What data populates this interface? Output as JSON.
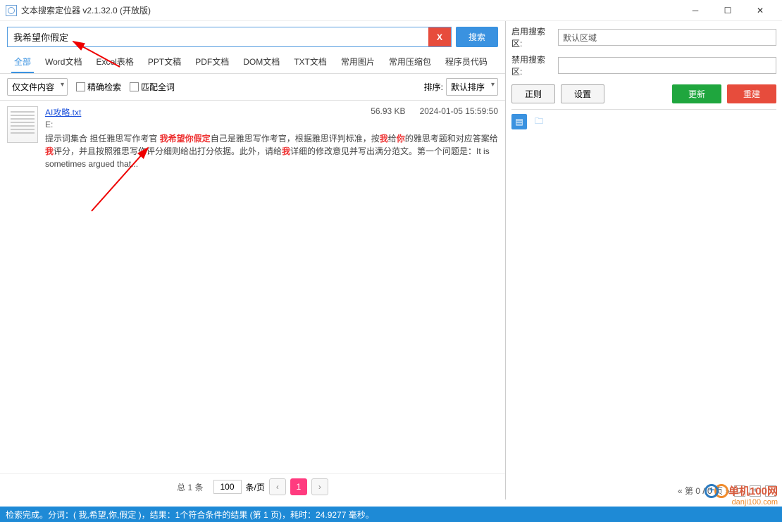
{
  "title": "文本搜索定位器 v2.1.32.0 (开放版)",
  "search": {
    "value": "我希望你假定",
    "clear": "X",
    "button": "搜索"
  },
  "tabs": [
    "全部",
    "Word文档",
    "Excel表格",
    "PPT文稿",
    "PDF文档",
    "DOM文档",
    "TXT文档",
    "常用图片",
    "常用压缩包",
    "程序员代码"
  ],
  "filter": {
    "mode": "仅文件内容",
    "exact": "精确检索",
    "whole": "匹配全词",
    "sort_label": "排序:",
    "sort_value": "默认排序"
  },
  "result": {
    "filename": "AI攻略.txt",
    "drive": "E:",
    "size": "56.93 KB",
    "date": "2024-01-05 15:59:50",
    "snip_a": "提示词集合    担任雅思写作考官 ",
    "snip_hl1": "我希望你假定",
    "snip_b": "自己是雅思写作考官，根据雅思评判标准，按",
    "snip_hl2": "我",
    "snip_c": "给",
    "snip_hl3": "你",
    "snip_d": "的雅思考题和对应答案给",
    "snip_hl4": "我",
    "snip_e": "评分，并且按照雅思写作评分细则给出打分依据。此外，请给",
    "snip_hl5": "我",
    "snip_f": "详细的修改意见并写出满分范文。第一个问题是：It is sometimes argued that..."
  },
  "pager": {
    "total": "总 1 条",
    "page_size": "100",
    "unit": "条/页",
    "current": "1"
  },
  "zones": {
    "enable_label": "启用搜索区:",
    "enable_value": "默认区域",
    "disable_label": "禁用搜索区:",
    "regex": "正则",
    "settings": "设置",
    "update": "更新",
    "rebuild": "重建"
  },
  "preview_footer": {
    "pages": "« 第 0 / 0 页 »"
  },
  "status": "检索完成。分词：( 我,希望,你,假定 )，结果：1个符合条件的结果 (第 1 页)，耗时：24.9277 毫秒。",
  "watermark": {
    "name": "单机100网",
    "url": "danji100.com"
  }
}
